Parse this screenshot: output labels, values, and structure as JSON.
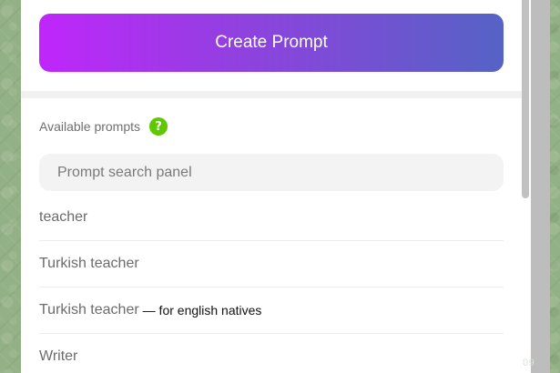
{
  "create_button": {
    "label": "Create Prompt"
  },
  "section": {
    "title": "Available prompts",
    "help_symbol": "?"
  },
  "search": {
    "placeholder": "Prompt search panel"
  },
  "prompts": [
    {
      "name": "teacher",
      "description": ""
    },
    {
      "name": "Turkish teacher",
      "description": ""
    },
    {
      "name": "Turkish teacher",
      "description": "— for english natives"
    },
    {
      "name": "Writer",
      "description": ""
    }
  ],
  "side_text": "09",
  "colors": {
    "gradient_start": "#c026fb",
    "gradient_end": "#5563c5",
    "help_badge": "#5fc800"
  }
}
